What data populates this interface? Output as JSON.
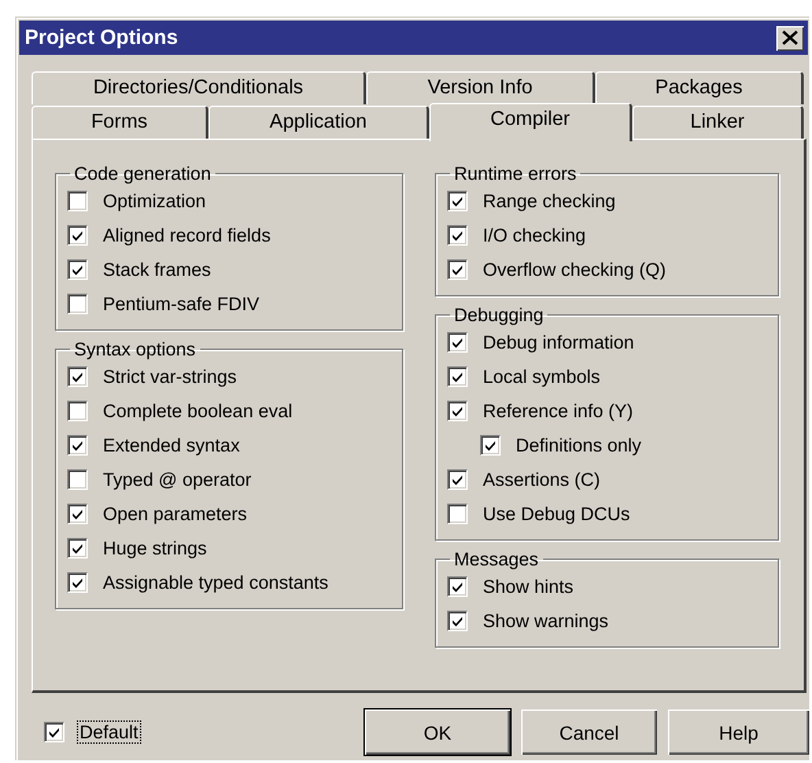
{
  "window": {
    "title": "Project Options"
  },
  "tab_rows": [
    [
      {
        "label": "Directories/Conditionals",
        "selected": false
      },
      {
        "label": "Version Info",
        "selected": false
      },
      {
        "label": "Packages",
        "selected": false
      }
    ],
    [
      {
        "label": "Forms",
        "selected": false
      },
      {
        "label": "Application",
        "selected": false
      },
      {
        "label": "Compiler",
        "selected": true
      },
      {
        "label": "Linker",
        "selected": false
      }
    ]
  ],
  "left_column": [
    {
      "title": "Code generation",
      "items": [
        {
          "label": "Optimization",
          "checked": false
        },
        {
          "label": "Aligned record fields",
          "checked": true
        },
        {
          "label": "Stack frames",
          "checked": true
        },
        {
          "label": "Pentium-safe FDIV",
          "checked": false
        }
      ]
    },
    {
      "title": "Syntax options",
      "items": [
        {
          "label": "Strict var-strings",
          "checked": true
        },
        {
          "label": "Complete boolean eval",
          "checked": false
        },
        {
          "label": "Extended syntax",
          "checked": true
        },
        {
          "label": "Typed @ operator",
          "checked": false
        },
        {
          "label": "Open parameters",
          "checked": true
        },
        {
          "label": "Huge strings",
          "checked": true
        },
        {
          "label": "Assignable typed constants",
          "checked": true
        }
      ]
    }
  ],
  "right_column": [
    {
      "title": "Runtime errors",
      "items": [
        {
          "label": "Range checking",
          "checked": true
        },
        {
          "label": "I/O checking",
          "checked": true
        },
        {
          "label": "Overflow checking (Q)",
          "checked": true
        }
      ]
    },
    {
      "title": "Debugging",
      "items": [
        {
          "label": "Debug information",
          "checked": true
        },
        {
          "label": "Local symbols",
          "checked": true
        },
        {
          "label": "Reference info (Y)",
          "checked": true,
          "children": [
            {
              "label": "Definitions only",
              "checked": true
            }
          ]
        },
        {
          "label": "Assertions (C)",
          "checked": true
        },
        {
          "label": "Use Debug DCUs",
          "checked": false
        }
      ]
    },
    {
      "title": "Messages",
      "items": [
        {
          "label": "Show hints",
          "checked": true
        },
        {
          "label": "Show warnings",
          "checked": true
        }
      ]
    }
  ],
  "default_checkbox": {
    "label": "Default",
    "checked": true,
    "focused": true
  },
  "buttons": [
    {
      "label": "OK",
      "default": true
    },
    {
      "label": "Cancel",
      "default": false
    },
    {
      "label": "Help",
      "default": false
    }
  ]
}
